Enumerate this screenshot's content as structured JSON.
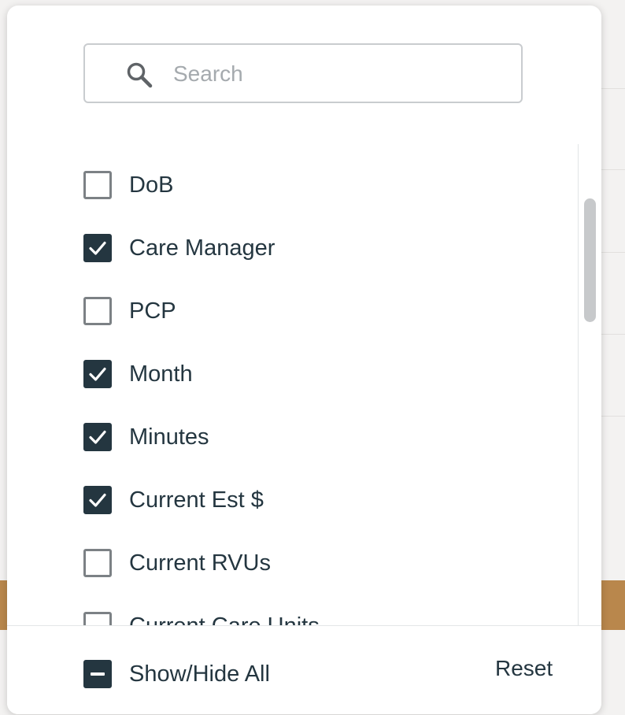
{
  "search": {
    "placeholder": "Search",
    "value": ""
  },
  "columns": [
    {
      "label": "DoB",
      "checked": false
    },
    {
      "label": "Care Manager",
      "checked": true
    },
    {
      "label": "PCP",
      "checked": false
    },
    {
      "label": "Month",
      "checked": true
    },
    {
      "label": "Minutes",
      "checked": true
    },
    {
      "label": "Current Est $",
      "checked": true
    },
    {
      "label": "Current RVUs",
      "checked": false
    },
    {
      "label": "Current Care Units",
      "checked": false
    }
  ],
  "footer": {
    "show_hide_all_label": "Show/Hide All",
    "show_hide_all_state": "indeterminate",
    "reset_label": "Reset"
  },
  "colors": {
    "checked_fill": "#243640",
    "unchecked_border": "#7c8185",
    "text": "#243640",
    "accent_background": "#b9874c"
  }
}
